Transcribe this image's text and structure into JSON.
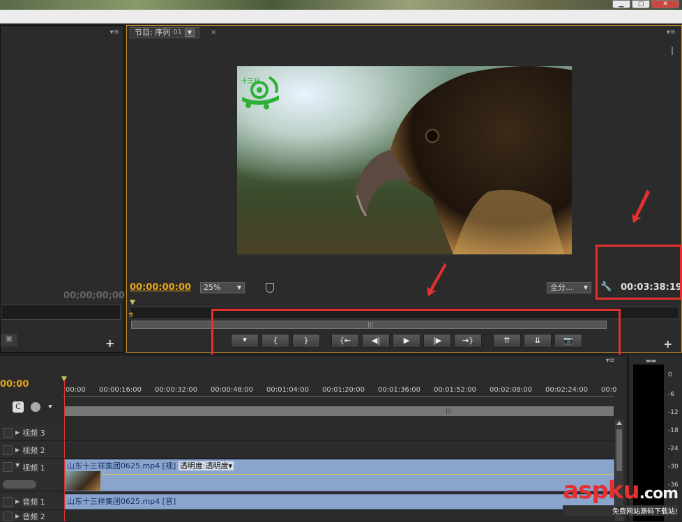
{
  "window": {
    "buttons": [
      "▁",
      "▢",
      "✕"
    ]
  },
  "program_monitor": {
    "tab_label": "节目: 序列",
    "tab_number": "01",
    "logo_text": "十三祥",
    "current_time": "00:00:00:00",
    "zoom": "25%",
    "quality": "全分...",
    "duration": "00:03:38:19"
  },
  "source_monitor": {
    "timecode": "00;00;00;00"
  },
  "transport": {
    "buttons": [
      {
        "name": "add-marker-button",
        "glyph": "⯆"
      },
      {
        "name": "mark-in-button",
        "glyph": "{"
      },
      {
        "name": "mark-out-button",
        "glyph": "}"
      },
      {
        "name": "go-to-in-button",
        "glyph": "{⇤"
      },
      {
        "name": "step-back-button",
        "glyph": "◀|"
      },
      {
        "name": "play-button",
        "glyph": "▶"
      },
      {
        "name": "step-forward-button",
        "glyph": "|▶"
      },
      {
        "name": "go-to-out-button",
        "glyph": "⇥}"
      },
      {
        "name": "lift-button",
        "glyph": "⇈"
      },
      {
        "name": "extract-button",
        "glyph": "⇊"
      },
      {
        "name": "export-frame-button",
        "glyph": "📷"
      }
    ]
  },
  "timeline": {
    "current_time": "00:00",
    "ticks": [
      "00:00",
      "00:00:16:00",
      "00:00:32:00",
      "00:00:48:00",
      "00:01:04:00",
      "00:01:20:00",
      "00:01:36:00",
      "00:01:52:00",
      "00:02:08:00",
      "00:02:24:00",
      "00:0"
    ],
    "tracks": [
      {
        "label": "视频 3"
      },
      {
        "label": "视频 2"
      },
      {
        "label": "视频 1"
      },
      {
        "label": "音频 1"
      },
      {
        "label": "音频 2"
      }
    ],
    "video_clip": {
      "name": "山东十三祥集团0625.mp4 [视]",
      "effect": "透明度:透明度"
    },
    "audio_clip": {
      "name": "山东十三祥集团0625.mp4 [音]"
    }
  },
  "meter": {
    "db_labels": [
      "0",
      "-6",
      "-12",
      "-18",
      "-24",
      "-30",
      "-36"
    ]
  },
  "watermark": {
    "brand": "aspku",
    "suffix": ".com",
    "tagline": "免费网站源码下载站!"
  },
  "colors": {
    "timecode_yellow": "#e3a51a",
    "highlight_red": "#e53030",
    "clip_blue": "#8aa4cc"
  }
}
